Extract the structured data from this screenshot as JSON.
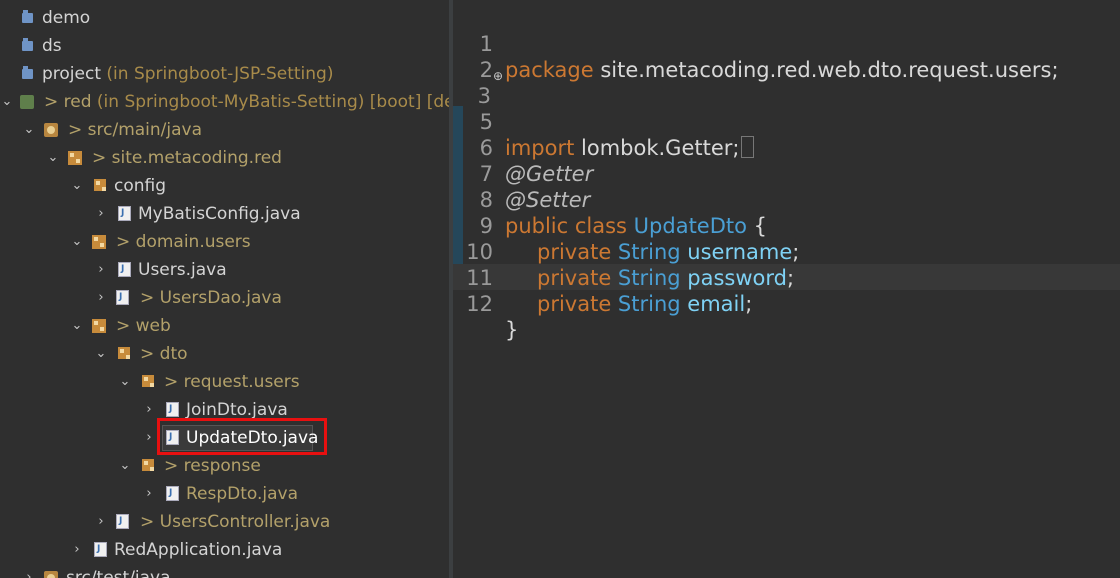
{
  "explorer": {
    "items": [
      {
        "label": "demo",
        "suffix": ""
      },
      {
        "label": "ds",
        "suffix": ""
      },
      {
        "label": "project",
        "suffix": " (in Springboot-JSP-Setting)"
      },
      {
        "label": "> red",
        "suffix": " (in Springboot-MyBatis-Setting) [boot] [dev"
      },
      {
        "label": "> src/main/java",
        "suffix": ""
      },
      {
        "label": "> site.metacoding.red",
        "suffix": ""
      },
      {
        "label": "config",
        "suffix": ""
      },
      {
        "label": "MyBatisConfig.java",
        "suffix": ""
      },
      {
        "label": "> domain.users",
        "suffix": ""
      },
      {
        "label": "Users.java",
        "suffix": ""
      },
      {
        "label": "> UsersDao.java",
        "suffix": ""
      },
      {
        "label": "> web",
        "suffix": ""
      },
      {
        "label": "> dto",
        "suffix": ""
      },
      {
        "label": "> request.users",
        "suffix": ""
      },
      {
        "label": "JoinDto.java",
        "suffix": ""
      },
      {
        "label": "UpdateDto.java",
        "suffix": ""
      },
      {
        "label": "> response",
        "suffix": ""
      },
      {
        "label": "RespDto.java",
        "suffix": ""
      },
      {
        "label": "> UsersController.java",
        "suffix": ""
      },
      {
        "label": "RedApplication.java",
        "suffix": ""
      },
      {
        "label": "src/test/java",
        "suffix": ""
      }
    ]
  },
  "editor": {
    "line_numbers": [
      "1",
      "2",
      "3",
      "5",
      "6",
      "7",
      "8",
      "9",
      "10",
      "11",
      "12"
    ],
    "lines": {
      "l1_kw": "package",
      "l1_rest": " site.metacoding.red.web.dto.request.users;",
      "l3_kw": "import",
      "l3_rest": " lombok.Getter;",
      "l6": "@Getter",
      "l7": "@Setter",
      "l8_kw": "public class",
      "l8_type": " UpdateDto",
      "l8_brace": " {",
      "l9_kw": "private",
      "l9_type": " String",
      "l9_field": " username",
      "l10_kw": "private",
      "l10_type": " String",
      "l10_field": " password",
      "l11_kw": "private",
      "l11_type": " String",
      "l11_field": " email",
      "semi": ";",
      "l12": "}"
    }
  },
  "colors": {
    "keyword": "#cc7832",
    "type": "#4a9fd4",
    "field": "#7fd2f5",
    "highlight": "#e81010"
  }
}
